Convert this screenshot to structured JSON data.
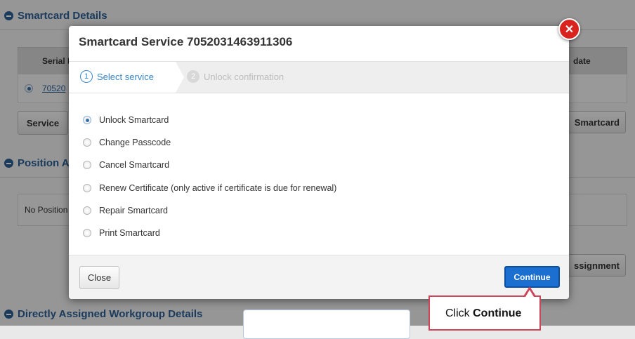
{
  "background": {
    "section1_title": "Smartcard Details",
    "table_col_serial": "Serial N",
    "table_col_update": "date",
    "serial_link": "70520",
    "service_button": "Service",
    "smartcard_button": "Smartcard",
    "section2_title": "Position A",
    "no_position_text": "No Position",
    "assignment_button": "ssignment",
    "section3_title": "Directly Assigned Workgroup Details"
  },
  "modal": {
    "title": "Smartcard Service 7052031463911306",
    "steps": [
      {
        "num": "1",
        "label": "Select service"
      },
      {
        "num": "2",
        "label": "Unlock confirmation"
      }
    ],
    "options": [
      {
        "label": "Unlock Smartcard",
        "checked": true
      },
      {
        "label": "Change Passcode",
        "checked": false
      },
      {
        "label": "Cancel Smartcard",
        "checked": false
      },
      {
        "label": "Renew Certificate (only active if certificate is due for renewal)",
        "checked": false
      },
      {
        "label": "Repair Smartcard",
        "checked": false
      },
      {
        "label": "Print Smartcard",
        "checked": false
      }
    ],
    "close_label": "Close",
    "continue_label": "Continue",
    "close_x": "✕"
  },
  "callout": {
    "prefix": "Click ",
    "bold": "Continue"
  },
  "colors": {
    "accent": "#3a87c8",
    "primary_button": "#1a6fd0",
    "close_icon": "#d9231e",
    "callout_border": "#d0445a"
  }
}
